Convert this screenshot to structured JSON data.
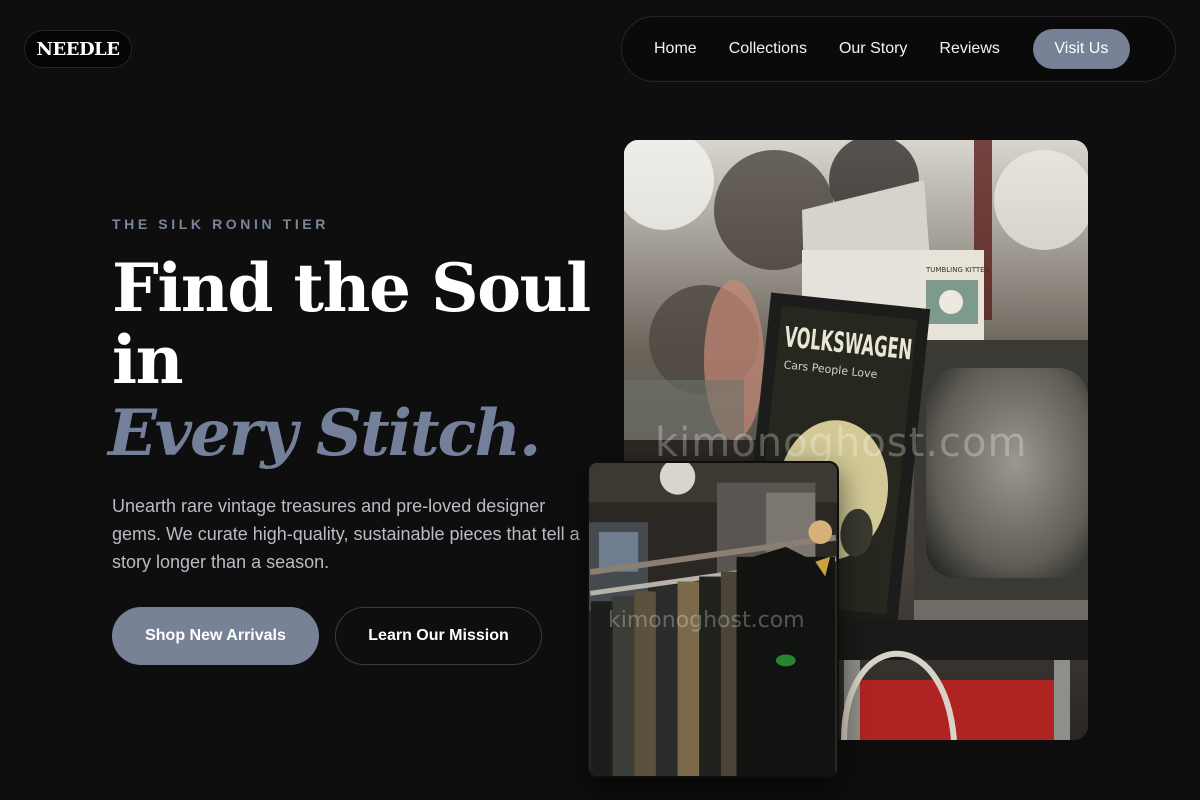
{
  "brand": {
    "logo_text": "NEEDLE"
  },
  "nav": {
    "links": [
      "Home",
      "Collections",
      "Our Story",
      "Reviews"
    ],
    "cta_label": "Visit Us"
  },
  "hero": {
    "eyebrow": "THE SILK RONIN TIER",
    "headline": "Find the Soul in",
    "headline_accent": "Every Stitch.",
    "description": "Unearth rare vintage treasures and pre-loved designer gems. We curate high-quality, sustainable pieces that tell a story longer than a season.",
    "primary_button": "Shop New Arrivals",
    "secondary_button": "Learn Our Mission"
  },
  "images": {
    "main_photo_sign_text": "VOLKSWAGEN",
    "main_photo_sign_subtext": "Cars People Love",
    "main_photo_box_text": "TUMBLING KITTEN",
    "watermark": "kimonoghost.com"
  },
  "colors": {
    "background": "#0e0e0f",
    "accent": "#778296",
    "accent_text": "#74809a",
    "eyebrow": "#7a8599"
  }
}
